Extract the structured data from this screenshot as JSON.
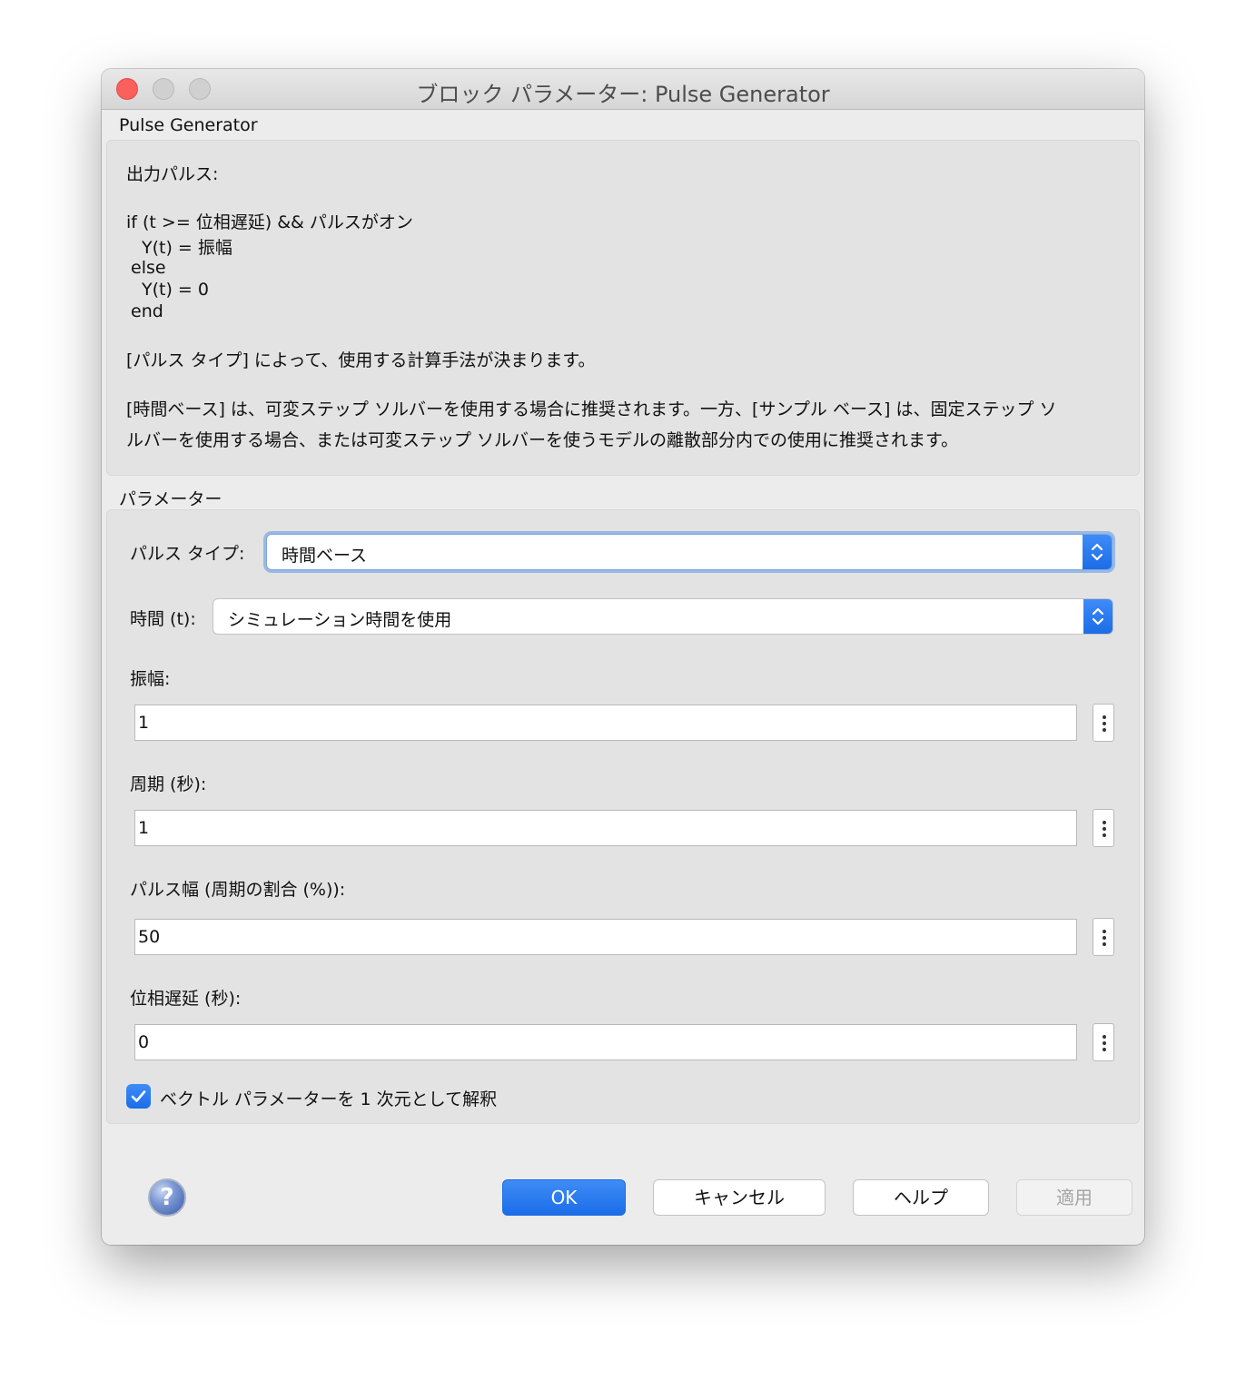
{
  "window": {
    "title": "ブロック パラメーター: Pulse Generator"
  },
  "block": {
    "name": "Pulse Generator",
    "description": {
      "output_heading": "出力パルス:",
      "code_lines": [
        "if (t >= 位相遅延) && パルスがオン",
        "Y(t) = 振幅",
        "else",
        "Y(t) = 0",
        "end"
      ],
      "pulse_type_note": "[パルス タイプ] によって、使用する計算手法が決まります。",
      "recommendation_lines": [
        "[時間ベース] は、可変ステップ ソルバーを使用する場合に推奨されます。一方、[サンプル ベース] は、固定ステップ ソ",
        "ルバーを使用する場合、または可変ステップ ソルバーを使うモデルの離散部分内での使用に推奨されます。"
      ]
    }
  },
  "parameters": {
    "heading": "パラメーター",
    "pulse_type": {
      "label": "パルス タイプ:",
      "value": "時間ベース"
    },
    "time": {
      "label": "時間 (t):",
      "value": "シミュレーション時間を使用"
    },
    "amplitude": {
      "label": "振幅:",
      "value": "1"
    },
    "period": {
      "label": "周期 (秒):",
      "value": "1"
    },
    "pulse_width": {
      "label": "パルス幅 (周期の割合 (%)):",
      "value": "50"
    },
    "phase_delay": {
      "label": "位相遅延 (秒):",
      "value": "0"
    },
    "interpret_vector": {
      "label": "ベクトル パラメーターを 1 次元として解釈",
      "checked": true
    }
  },
  "buttons": {
    "help_icon_glyph": "?",
    "ok": "OK",
    "cancel": "キャンセル",
    "help": "ヘルプ",
    "apply": "適用"
  },
  "colors": {
    "accent": "#1b6de8",
    "close_button": "#fc605c",
    "window_background": "#ececec",
    "panel_background": "#e3e3e3"
  },
  "icons": {
    "close": "close-icon",
    "stepper": "chevron-updown-icon",
    "more": "vertical-ellipsis-icon",
    "check": "checkmark-icon",
    "help": "question-mark-icon"
  }
}
